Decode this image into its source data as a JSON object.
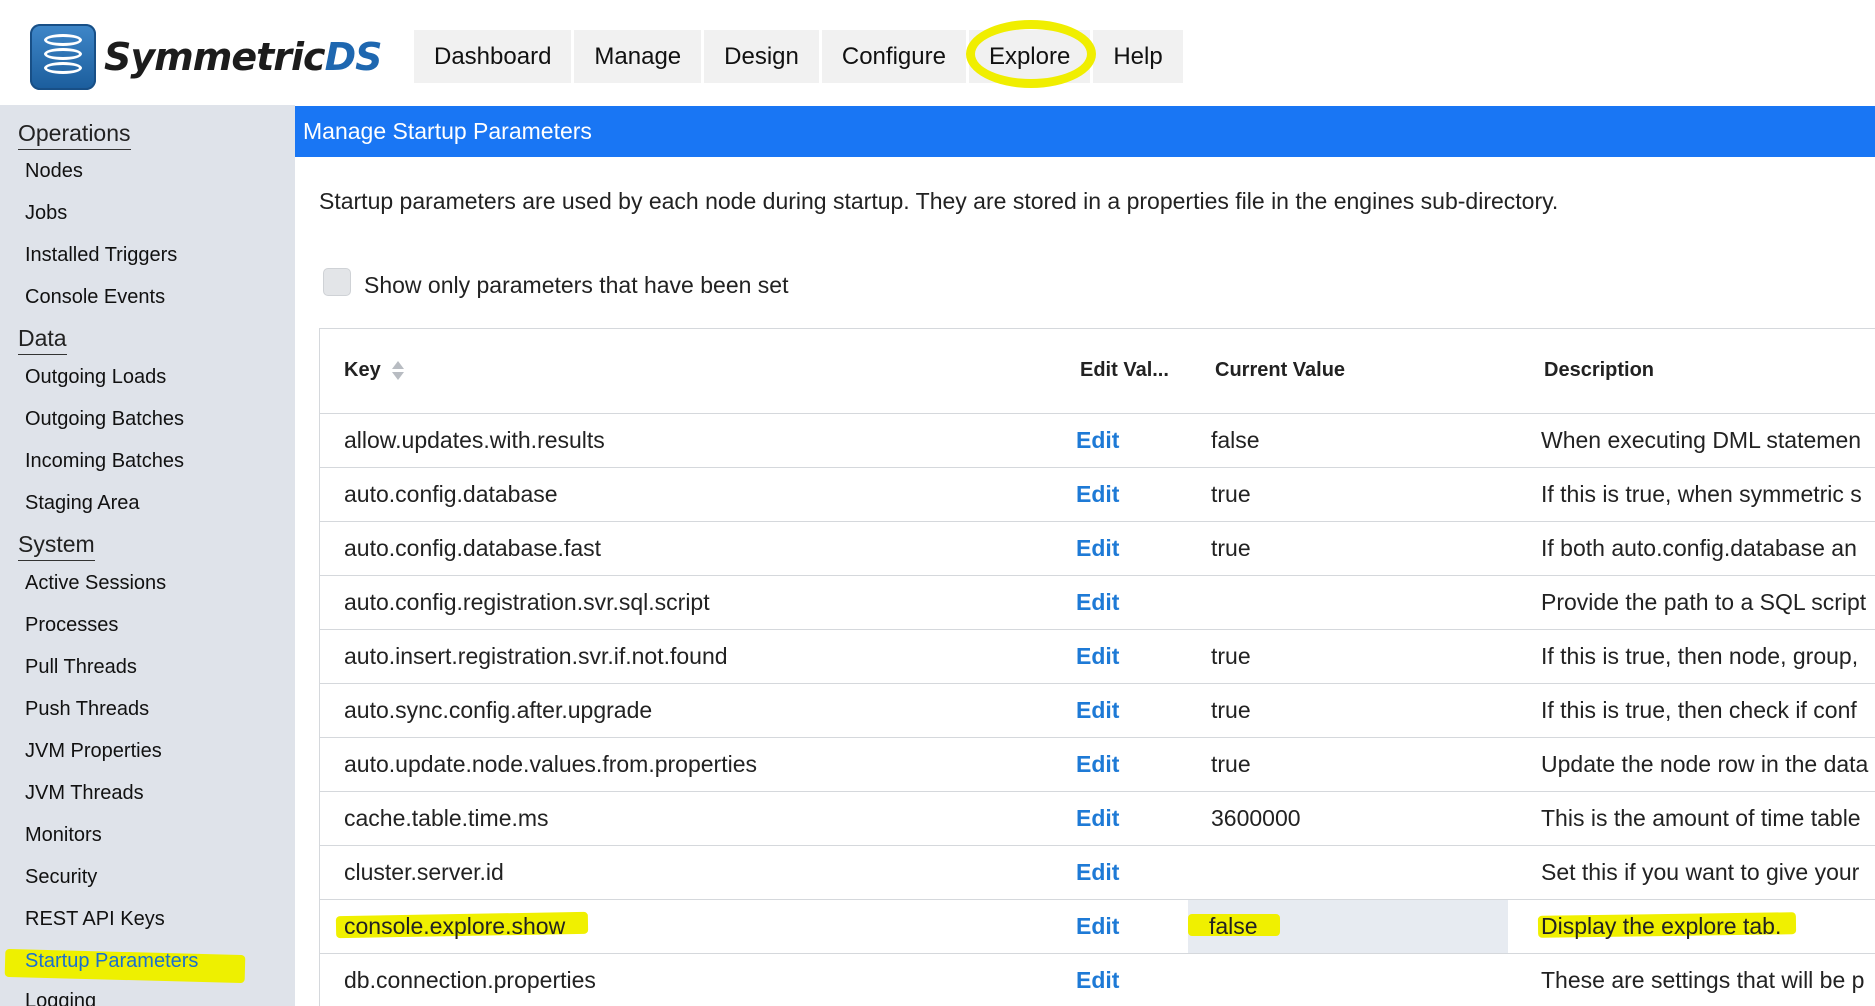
{
  "app": {
    "logo_text_primary": "Symmetric",
    "logo_text_secondary": "DS"
  },
  "topnav": {
    "tabs": [
      {
        "label": "Dashboard"
      },
      {
        "label": "Manage"
      },
      {
        "label": "Design"
      },
      {
        "label": "Configure"
      },
      {
        "label": "Explore"
      },
      {
        "label": "Help"
      }
    ]
  },
  "sidebar": {
    "groups": [
      {
        "label": "Operations",
        "items": [
          "Nodes",
          "Jobs",
          "Installed Triggers",
          "Console Events"
        ]
      },
      {
        "label": "Data",
        "items": [
          "Outgoing Loads",
          "Outgoing Batches",
          "Incoming Batches",
          "Staging Area"
        ]
      },
      {
        "label": "System",
        "items": [
          "Active Sessions",
          "Processes",
          "Pull Threads",
          "Push Threads",
          "JVM Properties",
          "JVM Threads",
          "Monitors",
          "Security",
          "REST API Keys",
          "Startup Parameters",
          "Logging"
        ]
      }
    ],
    "active_item": "Startup Parameters"
  },
  "main": {
    "title": "Manage Startup Parameters",
    "intro": "Startup parameters are used by each node during startup. They are stored in a properties file in the engines sub-directory.",
    "filter_checkbox": {
      "label": "Show only parameters that have been set",
      "checked": false
    }
  },
  "table": {
    "headers": {
      "key": "Key",
      "edit": "Edit Val...",
      "current": "Current Value",
      "description": "Description"
    },
    "rows": [
      {
        "key": "allow.updates.with.results",
        "edit": "Edit",
        "current": "false",
        "description": "When executing DML statemen"
      },
      {
        "key": "auto.config.database",
        "edit": "Edit",
        "current": "true",
        "description": "If this is true, when symmetric s"
      },
      {
        "key": "auto.config.database.fast",
        "edit": "Edit",
        "current": "true",
        "description": "If both auto.config.database an"
      },
      {
        "key": "auto.config.registration.svr.sql.script",
        "edit": "Edit",
        "current": "",
        "description": "Provide the path to a SQL script"
      },
      {
        "key": "auto.insert.registration.svr.if.not.found",
        "edit": "Edit",
        "current": "true",
        "description": "If this is true, then node, group,"
      },
      {
        "key": "auto.sync.config.after.upgrade",
        "edit": "Edit",
        "current": "true",
        "description": "If this is true, then check if conf"
      },
      {
        "key": "auto.update.node.values.from.properties",
        "edit": "Edit",
        "current": "true",
        "description": "Update the node row in the data"
      },
      {
        "key": "cache.table.time.ms",
        "edit": "Edit",
        "current": "3600000",
        "description": "This is the amount of time table"
      },
      {
        "key": "cluster.server.id",
        "edit": "Edit",
        "current": "",
        "description": "Set this if you want to give your"
      },
      {
        "key": "console.explore.show",
        "edit": "Edit",
        "current": "false",
        "description": "Display the explore tab."
      },
      {
        "key": "db.connection.properties",
        "edit": "Edit",
        "current": "",
        "description": "These are settings that will be p"
      }
    ]
  },
  "colors": {
    "titlebar": "#1976f4",
    "sidebar_bg": "#dfe3ea",
    "edit_link": "#1e7ad6",
    "highlighter": "#f0f000"
  }
}
